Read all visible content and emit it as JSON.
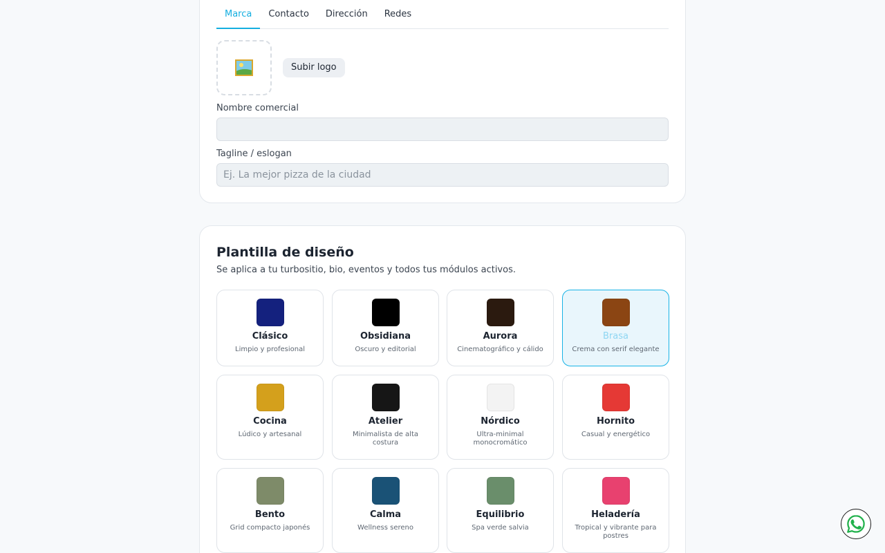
{
  "tabs": [
    {
      "label": "Marca",
      "active": true
    },
    {
      "label": "Contacto",
      "active": false
    },
    {
      "label": "Dirección",
      "active": false
    },
    {
      "label": "Redes",
      "active": false
    }
  ],
  "brand": {
    "logo_icon": "picture-icon",
    "upload_label": "Subir logo",
    "name_label": "Nombre comercial",
    "name_value": "",
    "tagline_label": "Tagline / eslogan",
    "tagline_placeholder": "Ej. La mejor pizza de la ciudad",
    "tagline_value": ""
  },
  "design": {
    "title": "Plantilla de diseño",
    "subtitle": "Se aplica a tu turbositio, bio, eventos y todos tus módulos activos.",
    "selected": "Brasa",
    "templates": [
      {
        "name": "Clásico",
        "desc": "Limpio y profesional",
        "color": "#14217e"
      },
      {
        "name": "Obsidiana",
        "desc": "Oscuro y editorial",
        "color": "#000000"
      },
      {
        "name": "Aurora",
        "desc": "Cinematográfico y cálido",
        "color": "#2b1a0f"
      },
      {
        "name": "Brasa",
        "desc": "Crema con serif elegante",
        "color": "#8b4513"
      },
      {
        "name": "Cocina",
        "desc": "Lúdico y artesanal",
        "color": "#d4a01c"
      },
      {
        "name": "Atelier",
        "desc": "Minimalista de alta costura",
        "color": "#161616"
      },
      {
        "name": "Nórdico",
        "desc": "Ultra-minimal monocromático",
        "color": "#f3f3f3"
      },
      {
        "name": "Hornito",
        "desc": "Casual y energético",
        "color": "#e53935"
      },
      {
        "name": "Bento",
        "desc": "Grid compacto japonés",
        "color": "#7e8b69"
      },
      {
        "name": "Calma",
        "desc": "Wellness sereno",
        "color": "#1a5276"
      },
      {
        "name": "Equilibrio",
        "desc": "Spa verde salvia",
        "color": "#6a8e6b"
      },
      {
        "name": "Heladería",
        "desc": "Tropical y vibrante para postres",
        "color": "#e8416f"
      }
    ]
  },
  "whatsapp": {
    "icon": "whatsapp-icon"
  },
  "colors": {
    "accent": "#14aee0",
    "selected_bg": "#e9f6fc"
  }
}
